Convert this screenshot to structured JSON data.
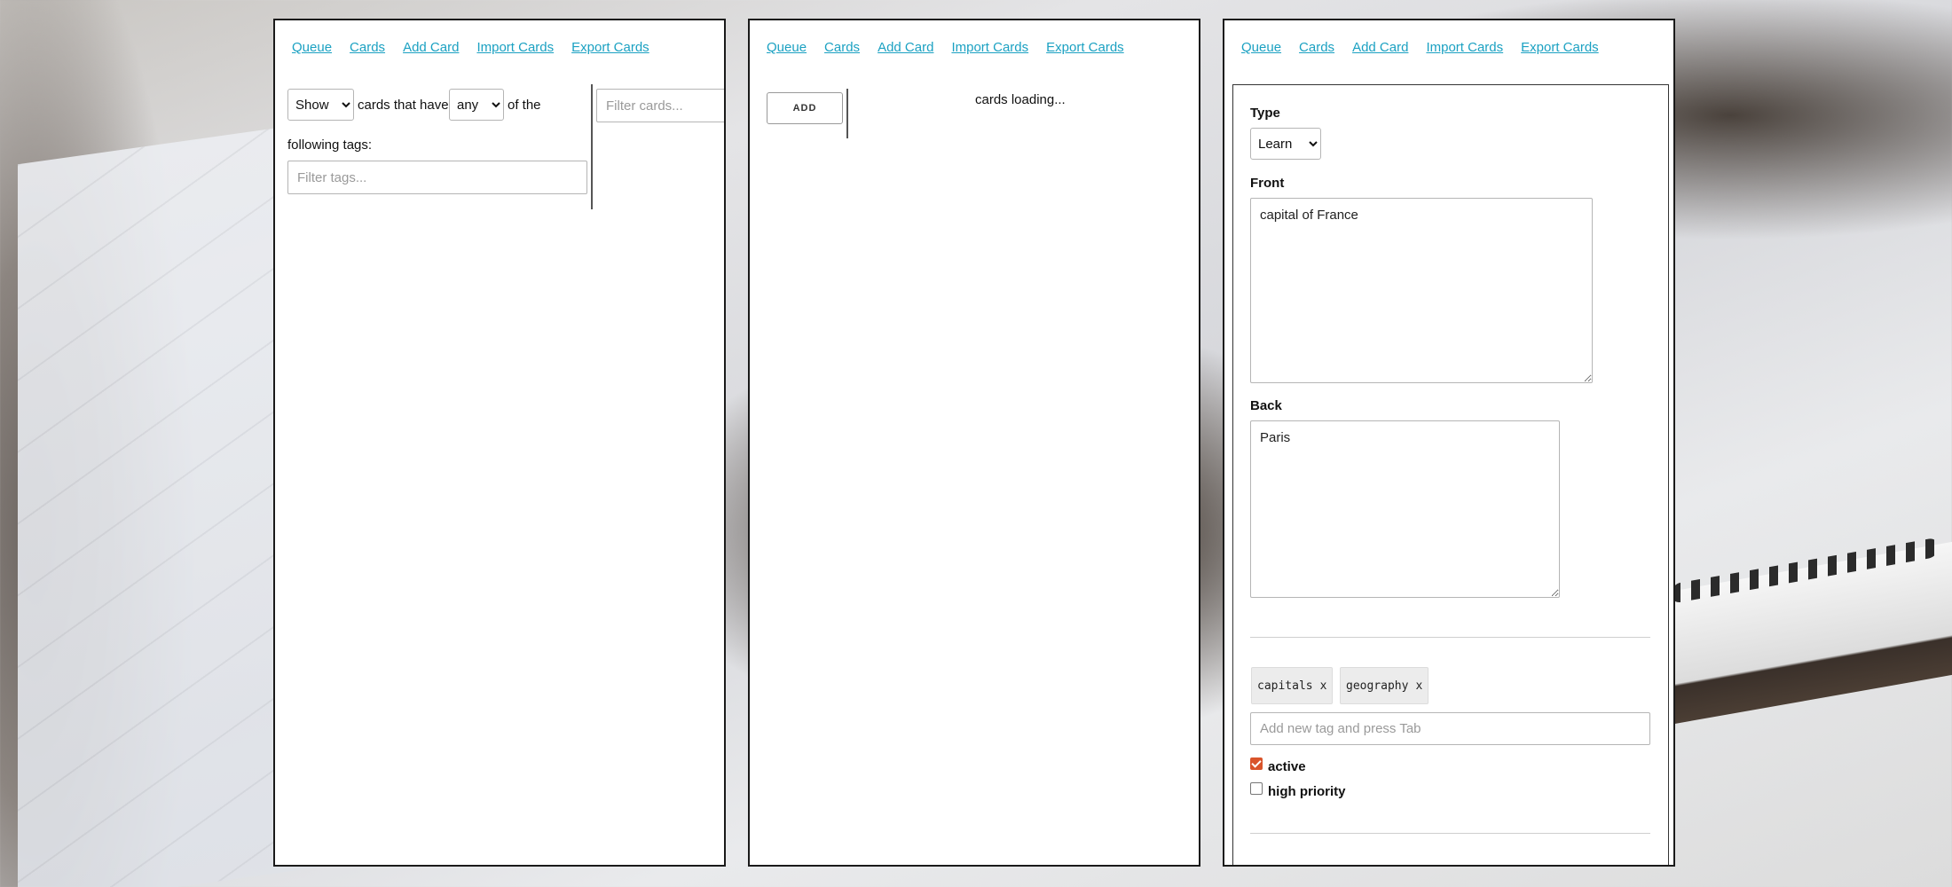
{
  "nav": [
    "Queue",
    "Cards",
    "Add Card",
    "Import Cards",
    "Export Cards"
  ],
  "panel1": {
    "show_select": "Show",
    "cards_that_have": "cards that have",
    "any_select": "any",
    "of_the": "of the",
    "following_tags": "following tags:",
    "filter_tags_placeholder": "Filter tags...",
    "filter_cards_placeholder": "Filter cards..."
  },
  "panel2": {
    "add_button": "ADD",
    "loading_text": "cards loading..."
  },
  "panel3": {
    "type_label": "Type",
    "type_value": "Learn",
    "front_label": "Front",
    "front_value": "capital of France",
    "back_label": "Back",
    "back_value": "Paris",
    "tags": [
      {
        "label": "capitals",
        "remove": "x"
      },
      {
        "label": "geography",
        "remove": "x"
      }
    ],
    "new_tag_placeholder": "Add new tag and press Tab",
    "active_label": "active",
    "active_checked": true,
    "high_priority_label": "high priority",
    "high_priority_checked": false
  },
  "colors": {
    "link": "#1ba1c2",
    "checkbox_accent": "#d9542b"
  }
}
